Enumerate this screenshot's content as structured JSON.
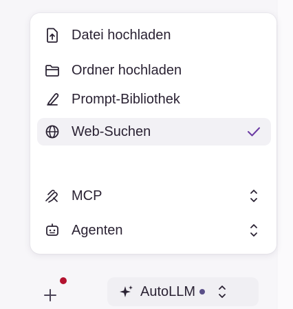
{
  "menu": {
    "items": [
      {
        "label": "Datei hochladen",
        "icon": "file-upload-icon"
      },
      {
        "label": "Ordner hochladen",
        "icon": "folder-icon"
      },
      {
        "label": "Prompt-Bibliothek",
        "icon": "library-icon"
      },
      {
        "label": "Web-Suchen",
        "icon": "globe-icon",
        "checked": true
      },
      {
        "label": "MCP",
        "icon": "mcp-icon"
      },
      {
        "label": "Agenten",
        "icon": "agent-icon"
      }
    ]
  },
  "composer": {
    "model_name": "AutoLLM",
    "plus_icon": "plus-icon",
    "notification_color": "#b3122f"
  },
  "colors": {
    "accent": "#6b3aa3",
    "active_row": "#f2f1f5"
  }
}
